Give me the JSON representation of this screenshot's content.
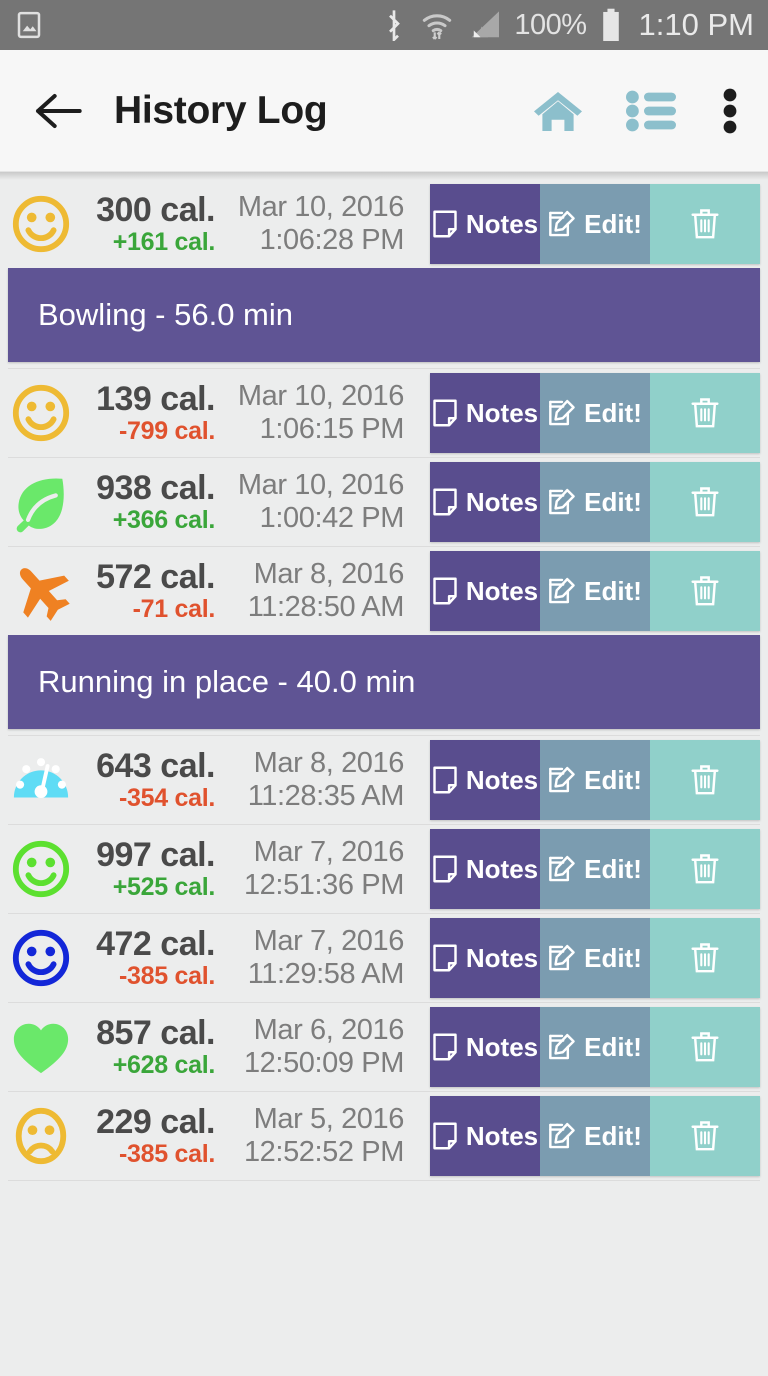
{
  "status_bar": {
    "image_icon": "photo-icon",
    "bluetooth_icon": "bluetooth-icon",
    "wifi_icon": "wifi-icon",
    "signal_icon": "cell-signal-icon",
    "battery_percent": "100%",
    "battery_icon": "battery-full-icon",
    "time": "1:10 PM",
    "background": "#757575"
  },
  "app_bar": {
    "back_icon": "arrow-left-icon",
    "title": "History Log",
    "actions": [
      {
        "name": "home-icon",
        "color": "#8cbfcc"
      },
      {
        "name": "list-icon",
        "color": "#8cbfcc"
      },
      {
        "name": "overflow-menu-icon",
        "color": "#1d1d1d"
      }
    ],
    "background": "#f7f7f7"
  },
  "colors": {
    "page_background": "#eceded",
    "notes_button": "#594d8e",
    "edit_button": "#7b9cb0",
    "delete_button": "#90d0ca",
    "activity_banner": "#5f5494",
    "delta_positive": "#3aa63a",
    "delta_negative": "#e0522e"
  },
  "row_buttons": {
    "notes_label": "Notes",
    "notes_icon": "note-icon",
    "edit_label": "Edit!",
    "edit_icon": "pencil-square-icon",
    "delete_icon": "trash-icon"
  },
  "entries": [
    {
      "icon": "smiley-face-icon",
      "icon_style": "outline",
      "icon_color": "#eeba33",
      "calories": "300 cal.",
      "delta": "+161 cal.",
      "delta_sign": "positive",
      "date": "Mar 10, 2016",
      "time": "1:06:28 PM",
      "activity": "Bowling - 56.0 min"
    },
    {
      "icon": "smiley-face-icon",
      "icon_style": "outline",
      "icon_color": "#eeba33",
      "calories": "139 cal.",
      "delta": "-799 cal.",
      "delta_sign": "negative",
      "date": "Mar 10, 2016",
      "time": "1:06:15 PM",
      "activity": null
    },
    {
      "icon": "leaf-icon",
      "icon_style": "solid",
      "icon_color": "#6ae86a",
      "calories": "938 cal.",
      "delta": "+366 cal.",
      "delta_sign": "positive",
      "date": "Mar 10, 2016",
      "time": "1:00:42 PM",
      "activity": null
    },
    {
      "icon": "airplane-icon",
      "icon_style": "solid",
      "icon_color": "#ef8122",
      "calories": "572 cal.",
      "delta": "-71 cal.",
      "delta_sign": "negative",
      "date": "Mar 8, 2016",
      "time": "11:28:50 AM",
      "activity": "Running in place - 40.0 min"
    },
    {
      "icon": "speedometer-icon",
      "icon_style": "solid",
      "icon_color": "#5fdcf5",
      "calories": "643 cal.",
      "delta": "-354 cal.",
      "delta_sign": "negative",
      "date": "Mar 8, 2016",
      "time": "11:28:35 AM",
      "activity": null
    },
    {
      "icon": "smiley-face-icon",
      "icon_style": "outline",
      "icon_color": "#5ce030",
      "calories": "997 cal.",
      "delta": "+525 cal.",
      "delta_sign": "positive",
      "date": "Mar 7, 2016",
      "time": "12:51:36 PM",
      "activity": null
    },
    {
      "icon": "smiley-face-icon",
      "icon_style": "outline",
      "icon_color": "#1327d8",
      "calories": "472 cal.",
      "delta": "-385 cal.",
      "delta_sign": "negative",
      "date": "Mar 7, 2016",
      "time": "11:29:58 AM",
      "activity": null
    },
    {
      "icon": "heart-icon",
      "icon_style": "solid",
      "icon_color": "#6ae86a",
      "calories": "857 cal.",
      "delta": "+628 cal.",
      "delta_sign": "positive",
      "date": "Mar 6, 2016",
      "time": "12:50:09 PM",
      "activity": null
    },
    {
      "icon": "sad-face-icon",
      "icon_style": "outline",
      "icon_color": "#eeba33",
      "calories": "229 cal.",
      "delta": "-385 cal.",
      "delta_sign": "negative",
      "date": "Mar 5, 2016",
      "time": "12:52:52 PM",
      "activity": null
    }
  ]
}
